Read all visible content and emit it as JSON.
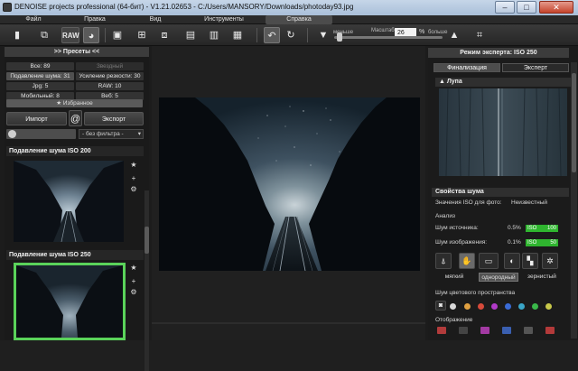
{
  "window": {
    "title": "DENOISE projects professional (64-бит) - V1.21.02653 - C:/Users/MANSORY/Downloads/photoday93.jpg",
    "controls": {
      "minimize": "–",
      "maximize": "□",
      "close": "✕"
    }
  },
  "menu": {
    "items": [
      "Файл",
      "Правка",
      "Вид",
      "Инструменты",
      "Справка"
    ],
    "active": "Справка"
  },
  "toolbar": {
    "raw_label": "RAW",
    "zoom": {
      "low_label": "меньше",
      "scale_label": "Масштаб",
      "high_label": "больше",
      "value": "26",
      "unit": "%"
    }
  },
  "presets_panel": {
    "title": ">> Пресеты <<",
    "stats": [
      {
        "label": "Все: 89",
        "state": "normal"
      },
      {
        "label": "Звездный",
        "state": "dim"
      },
      {
        "label": "Подавление шума: 31",
        "state": "active"
      },
      {
        "label": "Усиление резкости: 30",
        "state": "normal"
      },
      {
        "label": "Jpg: 5",
        "state": "normal"
      },
      {
        "label": "RAW: 10",
        "state": "normal"
      },
      {
        "label": "Мобильный: 8",
        "state": "normal"
      },
      {
        "label": "Веб: 5",
        "state": "normal"
      }
    ],
    "favorites_label": "Избранное",
    "import_label": "Импорт",
    "export_label": "Экспорт",
    "filter_value": "- без фильтра -",
    "presets": [
      {
        "title": "Подавление шума ISO 200"
      },
      {
        "title": "Подавление шума ISO 250"
      }
    ]
  },
  "expert_panel": {
    "title": "Режим эксперта: ISO 250",
    "tabs": [
      {
        "label": "Финализация",
        "active": true
      },
      {
        "label": "Эксперт",
        "active": false
      }
    ],
    "loupe_label": "Лупа",
    "noise_section": {
      "title": "Свойства шума",
      "iso_label": "Значения ISO для фото:",
      "iso_value": "Неизвестный",
      "analysis_label": "Анализ",
      "source_noise": {
        "label": "Шум источника:",
        "percent": "0.5%",
        "tag": "ISO",
        "value": "100"
      },
      "image_noise": {
        "label": "Шум изображения:",
        "percent": "0.1%",
        "tag": "ISO",
        "value": "50"
      },
      "modes": [
        {
          "label": "мягкий",
          "selected": false
        },
        {
          "label": "однородный",
          "selected": true
        },
        {
          "label": "зернистый",
          "selected": false
        }
      ],
      "color_space_label": "Шум цветового пространства",
      "color_swatches": [
        "#d9d9d9",
        "#e0a040",
        "#d64a3a",
        "#b13ac8",
        "#3a6bd6",
        "#3aa6c8",
        "#3ab84a",
        "#c8c84a"
      ],
      "display_label": "Отображение"
    }
  }
}
